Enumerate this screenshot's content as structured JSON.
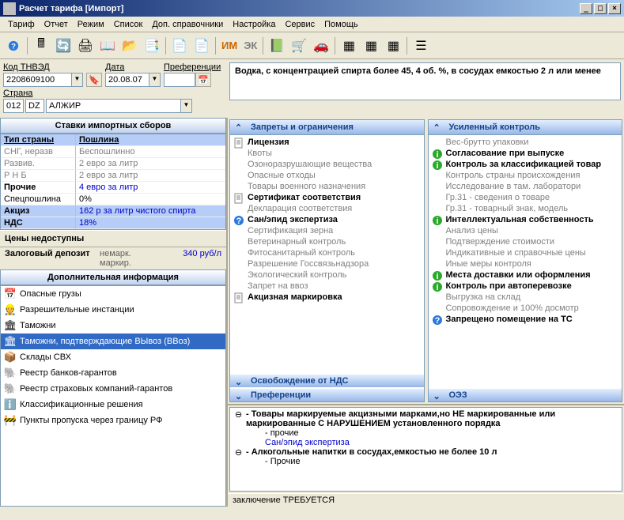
{
  "title": "Расчет тарифа [Импорт]",
  "menu": [
    "Тариф",
    "Отчет",
    "Режим",
    "Список",
    "Доп. справочники",
    "Настройка",
    "Сервис",
    "Помощь"
  ],
  "toolbar_imek": {
    "im": "ИМ",
    "ek": "ЭК"
  },
  "form": {
    "code_label": "Код ТНВЭД",
    "code": "2208609100",
    "date_label": "Дата",
    "date": "20.08.07",
    "pref_label": "Преференции",
    "pref": "",
    "country_label": "Страна",
    "country_code": "012",
    "country_iso": "DZ",
    "country_name": "АЛЖИР"
  },
  "description": "Водка, с концентрацией спирта более 45, 4 об. %, в сосудах емкостью 2 л или менее",
  "rates_header": "Ставки импортных сборов",
  "rates": {
    "col1": "Тип страны",
    "col2": "Пошлина",
    "rows": [
      {
        "l": "СНГ, неразв",
        "r": "Беспошлинно",
        "dim": true
      },
      {
        "l": "Развив.",
        "r": "2 евро за литр",
        "dim": true
      },
      {
        "l": "Р Н Б",
        "r": "2 евро за литр",
        "dim": true
      },
      {
        "l": "Прочие",
        "r": "4 евро за литр",
        "dim": false
      }
    ],
    "spec": {
      "l": "Спецпошлина",
      "r": "0%"
    },
    "akciz": {
      "l": "Акциз",
      "r": "162 р за литр чистого спирта"
    },
    "nds": {
      "l": "НДС",
      "r": "18%"
    }
  },
  "prices_header": "Цены недоступны",
  "deposit": {
    "label": "Залоговый депозит",
    "mark": "немарк. маркир.",
    "value": "340 руб/л"
  },
  "addl_header": "Дополнительная информация",
  "addl_items": [
    {
      "icon": "📅",
      "label": "Опасные грузы"
    },
    {
      "icon": "👷",
      "label": "Разрешительные инстанции"
    },
    {
      "icon": "🏛",
      "label": "Таможни"
    },
    {
      "icon": "🏛",
      "label": "Таможни, подтверждающие ВЫвоз (ВВоз)",
      "selected": true
    },
    {
      "icon": "📦",
      "label": "Склады СВХ"
    },
    {
      "icon": "🐘",
      "label": "Реестр банков-гарантов"
    },
    {
      "icon": "🐘",
      "label": "Реестр страховых компаний-гарантов"
    },
    {
      "icon": "ℹ️",
      "label": "Классификационные решения"
    },
    {
      "icon": "🚧",
      "label": "Пункты пропуска через границу РФ"
    }
  ],
  "col_left": {
    "header": "Запреты и ограничения",
    "items": [
      {
        "t": "Лицензия",
        "b": true,
        "i": "doc"
      },
      {
        "t": "Квоты"
      },
      {
        "t": "Озоноразрушающие вещества"
      },
      {
        "t": "Опасные отходы"
      },
      {
        "t": "Товары военного назначения"
      },
      {
        "t": "Сертификат соответствия",
        "b": true,
        "i": "doc"
      },
      {
        "t": "Декларация соответствия"
      },
      {
        "t": "Сан/эпид экспертиза",
        "b": true,
        "i": "q"
      },
      {
        "t": "Сертификация зерна"
      },
      {
        "t": "Ветеринарный контроль"
      },
      {
        "t": "Фитосанитарный контроль"
      },
      {
        "t": "Разрешение Госсвязьнадзора"
      },
      {
        "t": "Экологический контроль"
      },
      {
        "t": "Запрет на ввоз"
      },
      {
        "t": "Акцизная маркировка",
        "b": true,
        "i": "doc"
      }
    ],
    "sub1": "Освобождение от НДС",
    "sub2": "Преференции"
  },
  "col_right": {
    "header": "Усиленный контроль",
    "items": [
      {
        "t": "Вес-брутто упаковки"
      },
      {
        "t": "Согласование при выпуске",
        "b": true,
        "i": "info"
      },
      {
        "t": "Контроль за классификацией товар",
        "b": true,
        "i": "info"
      },
      {
        "t": "Контроль страны происхождения"
      },
      {
        "t": "Исследование в там. лаборатори"
      },
      {
        "t": "Гр.31 - сведения о товаре"
      },
      {
        "t": "Гр.31 - товарный знак, модель"
      },
      {
        "t": "Интеллектуальная собственность",
        "b": true,
        "i": "info"
      },
      {
        "t": "Анализ цены"
      },
      {
        "t": "Подтверждение стоимости"
      },
      {
        "t": "Индикативные и справочные цены"
      },
      {
        "t": "Иные меры контроля"
      },
      {
        "t": "Места доставки или оформления",
        "b": true,
        "i": "info"
      },
      {
        "t": "Контроль при автоперевозке",
        "b": true,
        "i": "info"
      },
      {
        "t": "Выгрузка на склад"
      },
      {
        "t": "Сопровождение и 100% досмотр"
      },
      {
        "t": "Запрещено помещение на ТС",
        "b": true,
        "i": "q"
      }
    ],
    "sub1": "ОЭЗ"
  },
  "tree": [
    {
      "lvl": 1,
      "txt": "- Товары маркируемые акцизными марками,но НЕ маркированные или маркированные С НАРУШЕНИЕМ установленного порядка",
      "b": true,
      "bullet": "⊖"
    },
    {
      "lvl": 2,
      "txt": "- прочие"
    },
    {
      "lvl": 2,
      "txt": "Сан/эпид экспертиза",
      "link": true
    },
    {
      "lvl": 1,
      "txt": "- Алкогольные напитки в сосудах,емкостью не более 10 л",
      "b": true,
      "bullet": "⊖"
    },
    {
      "lvl": 2,
      "txt": "- Прочие"
    }
  ],
  "status": "заключение ТРЕБУЕТСЯ"
}
